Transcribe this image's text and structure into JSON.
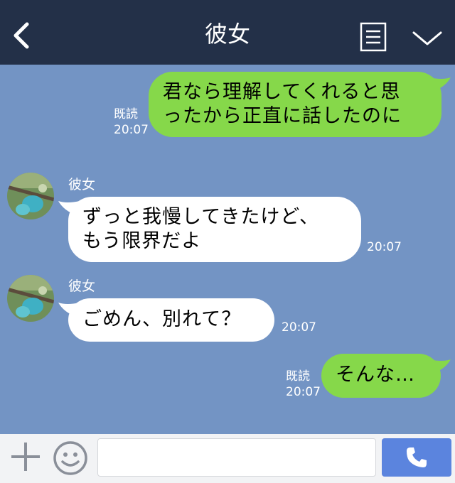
{
  "header": {
    "title": "彼女",
    "background": "#233048"
  },
  "colors": {
    "chat_background": "#7394c4",
    "sent_bubble": "#86d84a",
    "received_bubble": "#ffffff",
    "call_button": "#5b84de"
  },
  "messages": [
    {
      "direction": "sent",
      "text": "君なら理解してくれると思\nったから正直に話したのに",
      "read_label": "既読",
      "time": "20:07"
    },
    {
      "direction": "received",
      "sender": "彼女",
      "text": "ずっと我慢してきたけど、\nもう限界だよ",
      "time": "20:07"
    },
    {
      "direction": "received",
      "sender": "彼女",
      "text": "ごめん、別れて？",
      "time": "20:07"
    },
    {
      "direction": "sent",
      "text": "そんな…",
      "read_label": "既読",
      "time": "20:07"
    }
  ],
  "icons": {
    "back": "chevron-left-icon",
    "menu": "menu-icon",
    "collapse": "chevron-down-icon",
    "plus": "plus-icon",
    "emoji": "emoji-icon",
    "call": "phone-icon"
  },
  "footer": {
    "input_value": "",
    "input_placeholder": ""
  }
}
